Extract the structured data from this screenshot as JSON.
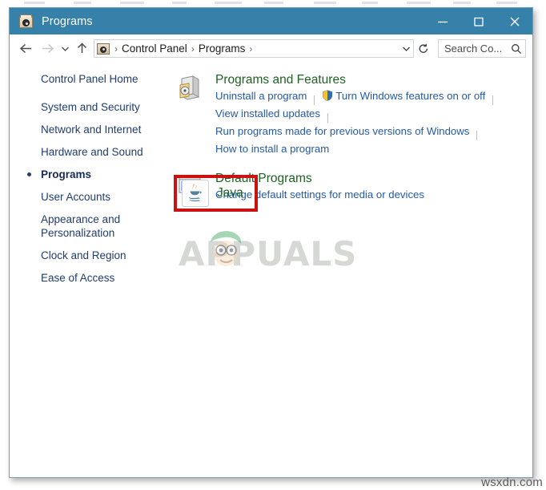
{
  "window": {
    "title": "Programs",
    "title_icon": "programs-window-icon",
    "caption": {
      "minimize": "minimize-button",
      "maximize": "maximize-button",
      "close": "close-button"
    },
    "titlebar_color": "#3581a9"
  },
  "navbar": {
    "back": "back-arrow-icon",
    "forward": "forward-arrow-icon",
    "recent": "recent-locations-chevron-icon",
    "up": "up-arrow-icon",
    "breadcrumb": {
      "icon": "control-panel-icon",
      "items": [
        "Control Panel",
        "Programs"
      ],
      "separator": "›",
      "dropdown": "address-dropdown-chevron-icon"
    },
    "refresh": "refresh-icon",
    "search": {
      "value": "Search Co...",
      "placeholder": "Search Control Panel",
      "icon": "search-icon"
    }
  },
  "sidebar": {
    "home": "Control Panel Home",
    "items": [
      {
        "label": "System and Security",
        "current": false
      },
      {
        "label": "Network and Internet",
        "current": false
      },
      {
        "label": "Hardware and Sound",
        "current": false
      },
      {
        "label": "Programs",
        "current": true
      },
      {
        "label": "User Accounts",
        "current": false
      },
      {
        "label": "Appearance and Personalization",
        "current": false
      },
      {
        "label": "Clock and Region",
        "current": false
      },
      {
        "label": "Ease of Access",
        "current": false
      }
    ]
  },
  "content": {
    "categories": [
      {
        "title": "Programs and Features",
        "icon": "programs-and-features-icon",
        "lines": [
          [
            {
              "text": "Uninstall a program",
              "shield": false,
              "sep_after": true
            },
            {
              "text": "Turn Windows features on or off",
              "shield": true,
              "sep_after": true
            }
          ],
          [
            {
              "text": "View installed updates",
              "shield": false,
              "sep_after": true
            }
          ],
          [
            {
              "text": "Run programs made for previous versions of Windows",
              "shield": false,
              "sep_after": true
            }
          ],
          [
            {
              "text": "How to install a program",
              "shield": false,
              "sep_after": false
            }
          ]
        ]
      },
      {
        "title": "Default Programs",
        "icon": "default-programs-icon",
        "lines": [
          [
            {
              "text": "Change default settings for media or devices",
              "shield": false,
              "sep_after": false
            }
          ]
        ]
      }
    ],
    "java_item": {
      "label": "Java",
      "icon": "java-icon",
      "highlight_color": "#cc1111"
    }
  },
  "watermarks": {
    "brand": "APPUALS",
    "brand_face": "appuals-mascot-icon",
    "site": "wsxdn.com"
  }
}
